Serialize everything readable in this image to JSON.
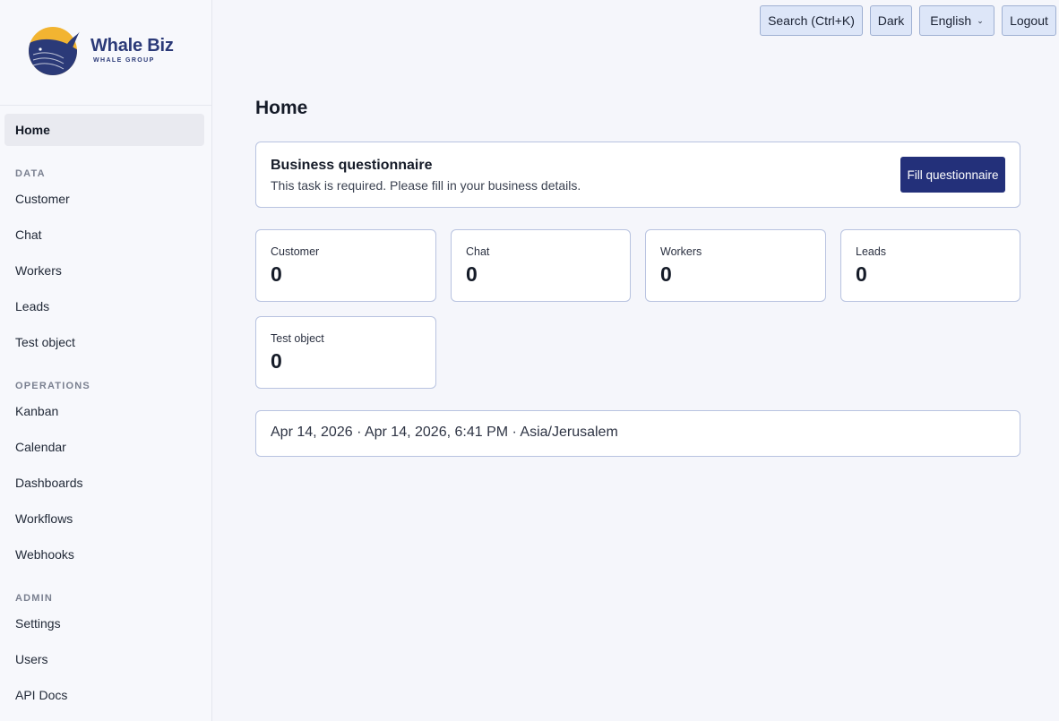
{
  "brand": {
    "name": "Whale Biz",
    "subtitle": "WHALE GROUP",
    "colors": {
      "navy": "#2b3a78",
      "sun": "#f2b431",
      "accent": "#23307a"
    }
  },
  "sidebar": {
    "home": "Home",
    "sections": [
      {
        "title": "DATA",
        "items": [
          "Customer",
          "Chat",
          "Workers",
          "Leads",
          "Test object"
        ]
      },
      {
        "title": "OPERATIONS",
        "items": [
          "Kanban",
          "Calendar",
          "Dashboards",
          "Workflows",
          "Webhooks"
        ]
      },
      {
        "title": "ADMIN",
        "items": [
          "Settings",
          "Users",
          "API Docs"
        ]
      }
    ]
  },
  "topbar": {
    "search": "Search (Ctrl+K)",
    "theme": "Dark",
    "language": "English",
    "language_icon": "chevron-down-icon",
    "logout": "Logout"
  },
  "main": {
    "title": "Home",
    "questionnaire": {
      "title": "Business questionnaire",
      "description": "This task is required. Please fill in your business details.",
      "button": "Fill questionnaire"
    },
    "stats": [
      {
        "label": "Customer",
        "value": "0"
      },
      {
        "label": "Chat",
        "value": "0"
      },
      {
        "label": "Workers",
        "value": "0"
      },
      {
        "label": "Leads",
        "value": "0"
      },
      {
        "label": "Test object",
        "value": "0"
      }
    ],
    "datetime": "Apr 14, 2026 · Apr 14, 2026, 6:41 PM · Asia/Jerusalem"
  }
}
